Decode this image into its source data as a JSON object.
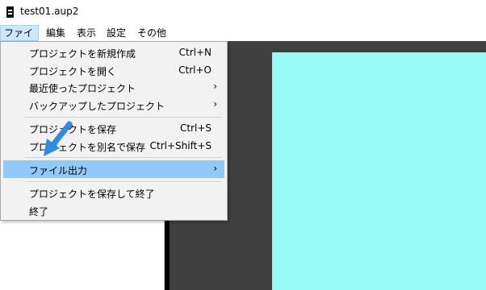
{
  "window": {
    "title": "test01.aup2",
    "icon": "film-icon"
  },
  "menubar": {
    "items": [
      {
        "label": "ファイル",
        "active": true
      },
      {
        "label": "編集"
      },
      {
        "label": "表示"
      },
      {
        "label": "設定"
      },
      {
        "label": "その他"
      }
    ]
  },
  "file_menu": {
    "items": [
      {
        "label": "プロジェクトを新規作成",
        "shortcut": "Ctrl+N"
      },
      {
        "label": "プロジェクトを開く",
        "shortcut": "Ctrl+O"
      },
      {
        "label": "最近使ったプロジェクト",
        "submenu_arrow": "›"
      },
      {
        "label": "バックアップしたプロジェクト",
        "submenu_arrow": "›"
      },
      {
        "label": "プロジェクトを保存",
        "shortcut": "Ctrl+S"
      },
      {
        "label": "プロジェクトを別名で保存",
        "shortcut": "Ctrl+Shift+S"
      },
      {
        "label": "ファイル出力",
        "submenu_arrow": "›",
        "highlighted": true
      },
      {
        "label": "プロジェクトを保存して終了"
      },
      {
        "label": "終了"
      }
    ]
  },
  "colors": {
    "menu_highlight": "#91c9f7",
    "preview_background": "#404040",
    "canvas": "#99fbf6",
    "annotation_arrow": "#2e8be0"
  }
}
